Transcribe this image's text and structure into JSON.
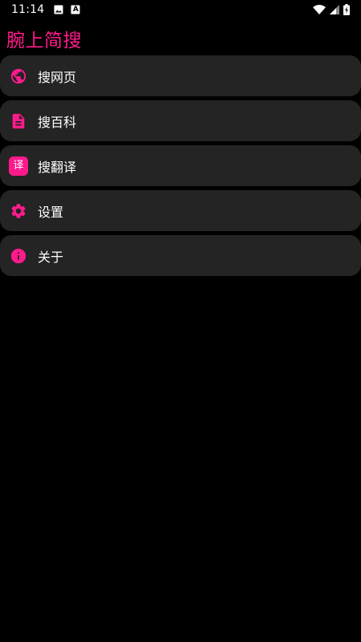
{
  "status_bar": {
    "time": "11:14",
    "notif_app_letter": "A",
    "icons": [
      "image-icon",
      "app-notification-icon",
      "wifi-icon",
      "signal-icon",
      "battery-charging-icon"
    ]
  },
  "app": {
    "title": "腕上简搜",
    "accent_color": "#ff1a8c"
  },
  "menu": {
    "items": [
      {
        "label": "搜网页",
        "icon": "globe-icon"
      },
      {
        "label": "搜百科",
        "icon": "document-icon"
      },
      {
        "label": "搜翻译",
        "icon": "translate-icon",
        "badge": "译"
      },
      {
        "label": "设置",
        "icon": "gear-icon"
      },
      {
        "label": "关于",
        "icon": "info-icon"
      }
    ]
  }
}
